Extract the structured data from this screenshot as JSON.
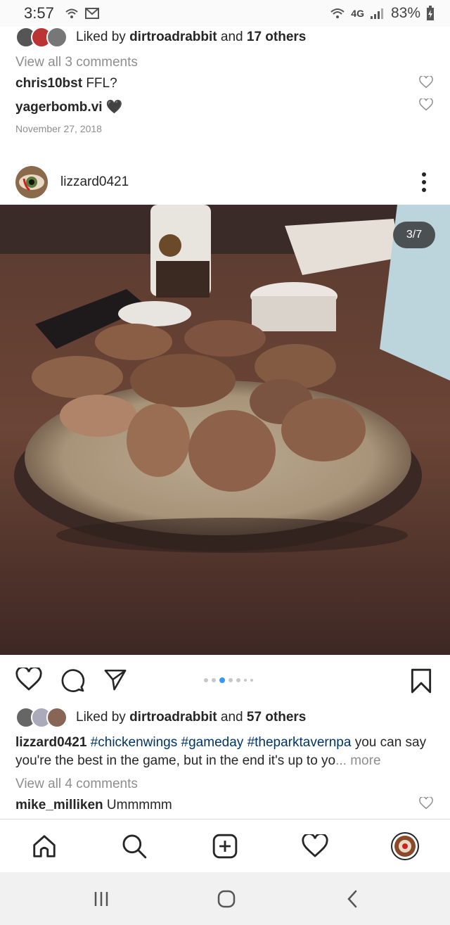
{
  "status_bar": {
    "time": "3:57",
    "network": "4G",
    "battery": "83%"
  },
  "previous_post": {
    "likes_prefix": "Liked by",
    "likes_user": "dirtroadrabbit",
    "likes_and": "and",
    "likes_others": "17 others",
    "view_comments": "View all 3 comments",
    "comments": [
      {
        "user": "chris10bst",
        "text": "FFL?"
      },
      {
        "user": "yagerbomb.vi",
        "text": "🖤"
      }
    ],
    "date": "November 27, 2018"
  },
  "post": {
    "username": "lizzard0421",
    "counter": "3/7",
    "carousel_total": 7,
    "carousel_index": 3,
    "likes_prefix": "Liked by",
    "likes_user": "dirtroadrabbit",
    "likes_and": "and",
    "likes_others": "57 others",
    "caption_user": "lizzard0421",
    "caption_tags": [
      "#chickenwings",
      "#gameday",
      "#theparktavernpa"
    ],
    "caption_text": "you can say you're the best in the game, but in the end it's up to yo",
    "caption_more": "... more",
    "view_comments": "View all 4 comments",
    "comments": [
      {
        "user": "mike_milliken",
        "text": "Ummmmm"
      }
    ]
  },
  "bottom_nav": [
    "home-icon",
    "search-icon",
    "add-post-icon",
    "activity-heart-icon",
    "profile-avatar"
  ],
  "android_nav": [
    "recents-icon",
    "home-button-icon",
    "back-icon"
  ],
  "colors": {
    "link": "#003569",
    "muted": "#8e8e8e",
    "active_dot": "#3897f0",
    "text": "#262626"
  }
}
